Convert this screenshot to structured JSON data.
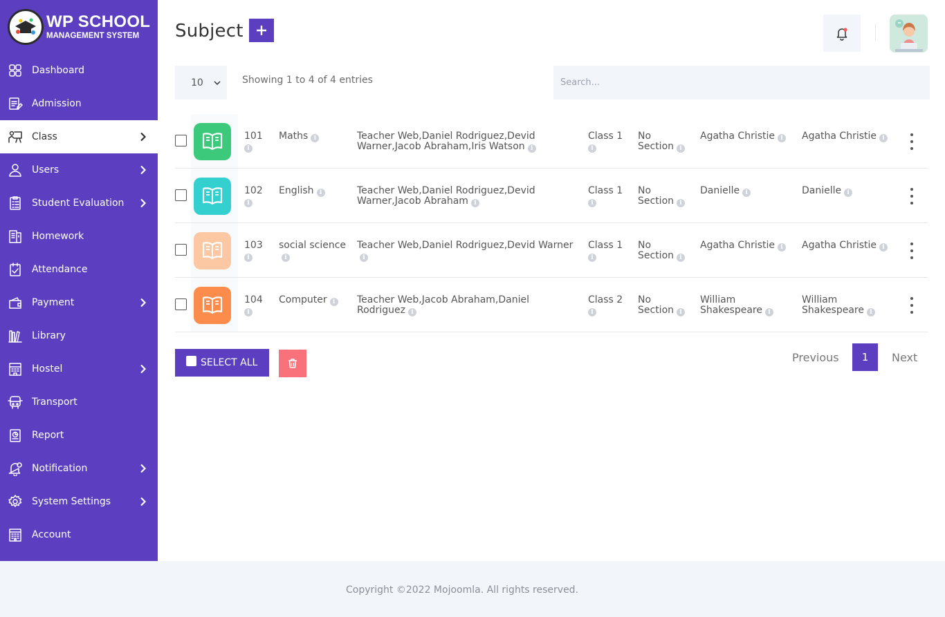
{
  "brand": {
    "title": "WP SCHOOL",
    "subtitle": "MANAGEMENT SYSTEM"
  },
  "sidebar": {
    "items": [
      {
        "label": "Dashboard",
        "icon": "dashboard-grid-icon",
        "has_children": false,
        "active": false
      },
      {
        "label": "Admission",
        "icon": "admission-form-icon",
        "has_children": false,
        "active": false
      },
      {
        "label": "Class",
        "icon": "class-icon",
        "has_children": true,
        "active": true
      },
      {
        "label": "Users",
        "icon": "user-icon",
        "has_children": true,
        "active": false
      },
      {
        "label": "Student Evaluation",
        "icon": "evaluation-clipboard-icon",
        "has_children": true,
        "active": false
      },
      {
        "label": "Homework",
        "icon": "homework-icon",
        "has_children": false,
        "active": false
      },
      {
        "label": "Attendance",
        "icon": "attendance-check-icon",
        "has_children": false,
        "active": false
      },
      {
        "label": "Payment",
        "icon": "wallet-icon",
        "has_children": true,
        "active": false
      },
      {
        "label": "Library",
        "icon": "library-books-icon",
        "has_children": false,
        "active": false
      },
      {
        "label": "Hostel",
        "icon": "hostel-building-icon",
        "has_children": true,
        "active": false
      },
      {
        "label": "Transport",
        "icon": "bus-icon",
        "has_children": false,
        "active": false
      },
      {
        "label": "Report",
        "icon": "report-icon",
        "has_children": false,
        "active": false
      },
      {
        "label": "Notification",
        "icon": "notification-bell-icon",
        "has_children": true,
        "active": false
      },
      {
        "label": "System Settings",
        "icon": "gear-icon",
        "has_children": true,
        "active": false
      },
      {
        "label": "Account",
        "icon": "account-building-icon",
        "has_children": false,
        "active": false
      }
    ]
  },
  "header": {
    "title": "Subject",
    "add_label": "+"
  },
  "controls": {
    "page_length": "10",
    "info": "Showing 1 to 4 of 4 entries",
    "search_placeholder": "Search..."
  },
  "rows": [
    {
      "color": "#3cc97b",
      "code": "101",
      "name": "Maths",
      "teachers": "Teacher Web,Daniel Rodriguez,Devid Warner,Jacob Abraham,Iris Watson",
      "class": "Class 1",
      "section": "No Section",
      "teacher1": "Agatha Christie",
      "teacher2": "Agatha Christie"
    },
    {
      "color": "#34d0d0",
      "code": "102",
      "name": "English",
      "teachers": "Teacher Web,Daniel Rodriguez,Devid Warner,Jacob Abraham",
      "class": "Class 1",
      "section": "No Section",
      "teacher1": "Danielle",
      "teacher2": "Danielle"
    },
    {
      "color": "#fcc7a3",
      "code": "103",
      "name": "social science",
      "teachers": "Teacher Web,Daniel Rodriguez,Devid Warner",
      "class": "Class 1",
      "section": "No Section",
      "teacher1": "Agatha Christie",
      "teacher2": "Agatha Christie"
    },
    {
      "color": "#fb8c4c",
      "code": "104",
      "name": "Computer",
      "teachers": "Teacher Web,Jacob Abraham,Daniel Rodriguez",
      "class": "Class 2",
      "section": "No Section",
      "teacher1": "William Shakespeare",
      "teacher2": "William Shakespeare"
    }
  ],
  "actions": {
    "select_all": "SELECT ALL"
  },
  "pagination": {
    "previous": "Previous",
    "current": "1",
    "next": "Next"
  },
  "footer": {
    "text": "Copyright ©2022 Mojoomla. All rights reserved."
  },
  "colors": {
    "primary": "#5b3fc0",
    "delete": "#f8717b",
    "surface": "#f2f5fa"
  }
}
